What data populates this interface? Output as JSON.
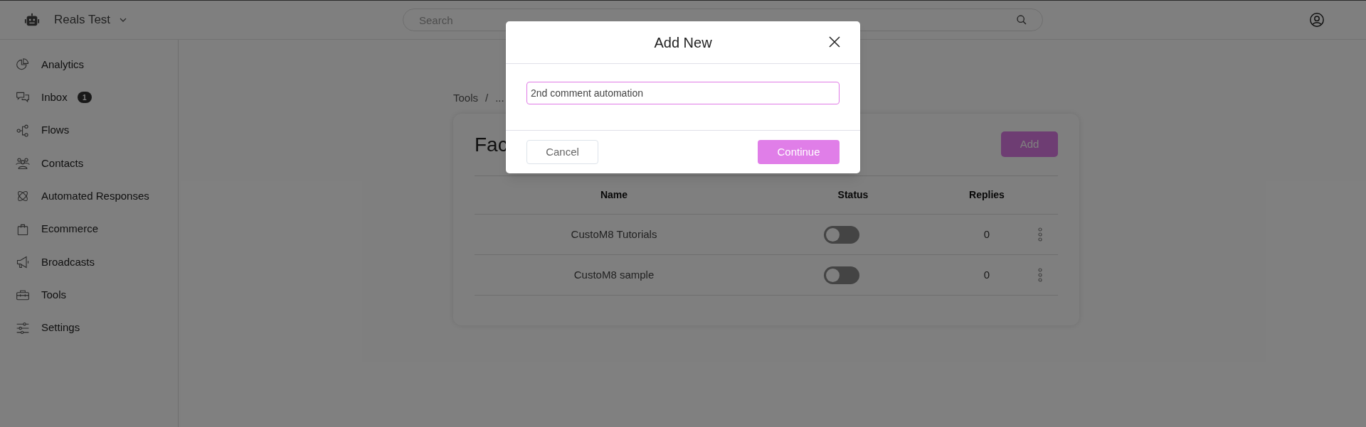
{
  "header": {
    "workspace": "Reals Test",
    "search": {
      "placeholder": "Search"
    }
  },
  "sidebar": {
    "items": [
      {
        "label": "Analytics",
        "kind": "analytics"
      },
      {
        "label": "Inbox",
        "kind": "inbox",
        "badge": "1"
      },
      {
        "label": "Flows",
        "kind": "flows"
      },
      {
        "label": "Contacts",
        "kind": "contacts"
      },
      {
        "label": "Automated Responses",
        "kind": "atom"
      },
      {
        "label": "Ecommerce",
        "kind": "bag"
      },
      {
        "label": "Broadcasts",
        "kind": "megaphone"
      },
      {
        "label": "Tools",
        "kind": "toolbox"
      },
      {
        "label": "Settings",
        "kind": "sliders"
      }
    ]
  },
  "breadcrumb": {
    "separator": "/",
    "items": [
      "Tools",
      "..."
    ]
  },
  "card": {
    "title": "Fac",
    "add_button": "Add",
    "table": {
      "columns": [
        "Name",
        "Status",
        "Replies"
      ],
      "rows": [
        {
          "name": "CustoM8 Tutorials",
          "on": false,
          "replies": "0"
        },
        {
          "name": "CustoM8 sample",
          "on": false,
          "replies": "0"
        }
      ]
    }
  },
  "modal": {
    "title": "Add New",
    "input": {
      "value": "2nd comment automation"
    },
    "buttons": {
      "cancel": "Cancel",
      "confirm": "Continue"
    }
  }
}
